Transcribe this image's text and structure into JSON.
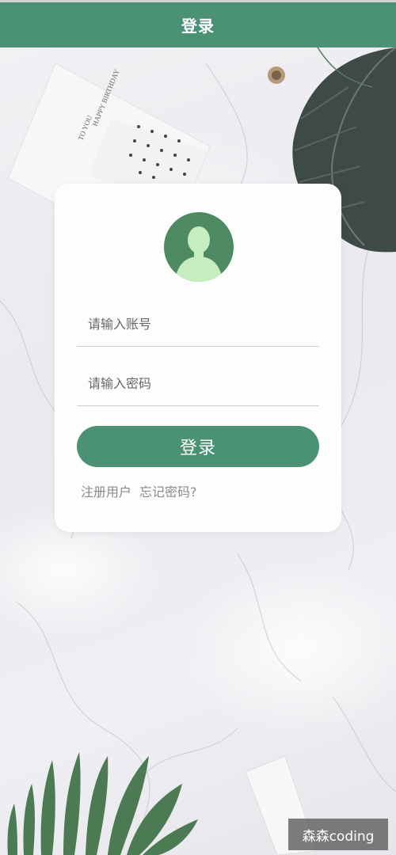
{
  "header": {
    "title": "登录"
  },
  "login_form": {
    "username_placeholder": "请输入账号",
    "password_placeholder": "请输入密码",
    "submit_label": "登录",
    "register_link": "注册用户",
    "forgot_link": "忘记密码?"
  },
  "background": {
    "card_text_1": "HAPPY BIRTHDAY",
    "card_text_2": "TO YOU"
  },
  "watermark": {
    "text": "森森coding"
  },
  "colors": {
    "primary": "#4a9176",
    "avatar_bg": "#4d8a62",
    "avatar_figure": "#c6ecc0"
  }
}
